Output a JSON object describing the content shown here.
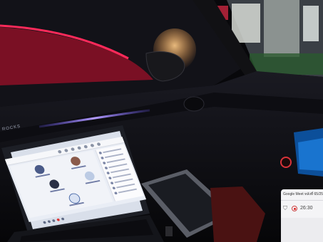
{
  "scene": {
    "description_tags": [
      "car-interior",
      "night",
      "laptop",
      "phone-mount"
    ],
    "colors": {
      "ambient_light": "#9b7cff",
      "red_car": "#e0204a",
      "laptop_screen": "#e9edf5",
      "infotainment": "#2a8fe0",
      "street_glow": "#ffb36b"
    }
  },
  "laptop": {
    "brand_text": "ROCKS"
  },
  "notification": {
    "title": "Google Meet  หลังที่ 65/256",
    "timer": "26:30",
    "icons": [
      "shield-icon",
      "record-icon"
    ]
  }
}
